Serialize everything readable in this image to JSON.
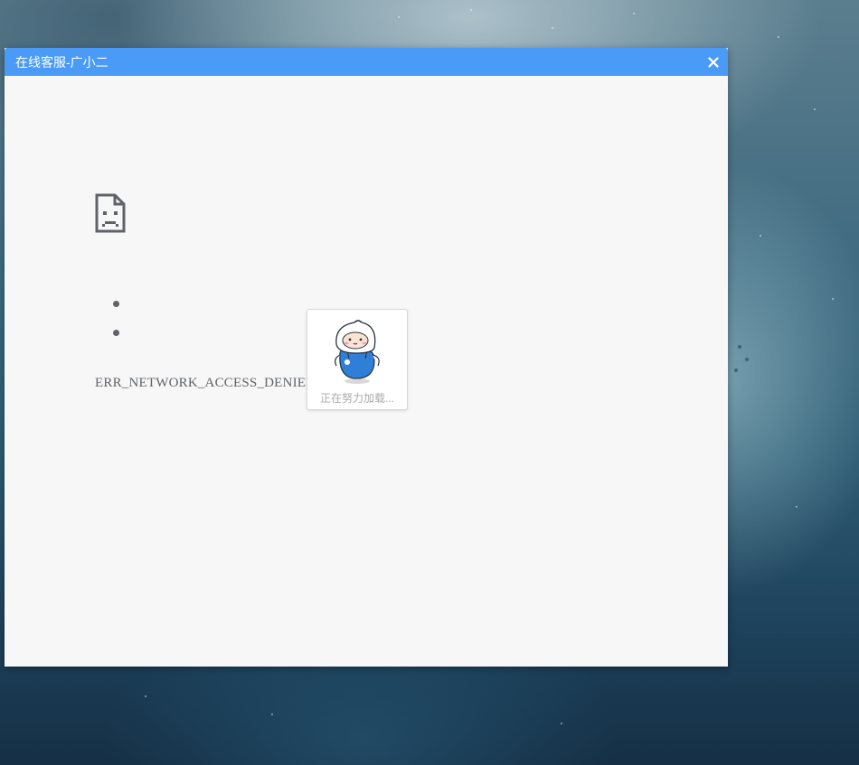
{
  "window": {
    "title": "在线客服-广小二",
    "close_glyph": "✕"
  },
  "error": {
    "icon": "sad-page-icon",
    "code": "ERR_NETWORK_ACCESS_DENIED"
  },
  "loader": {
    "icon": "mascot-icon",
    "text": "正在努力加载..."
  },
  "colors": {
    "titlebar": "#4a9bf7",
    "content_bg": "#f7f7f7",
    "error_text": "#5f6368"
  }
}
